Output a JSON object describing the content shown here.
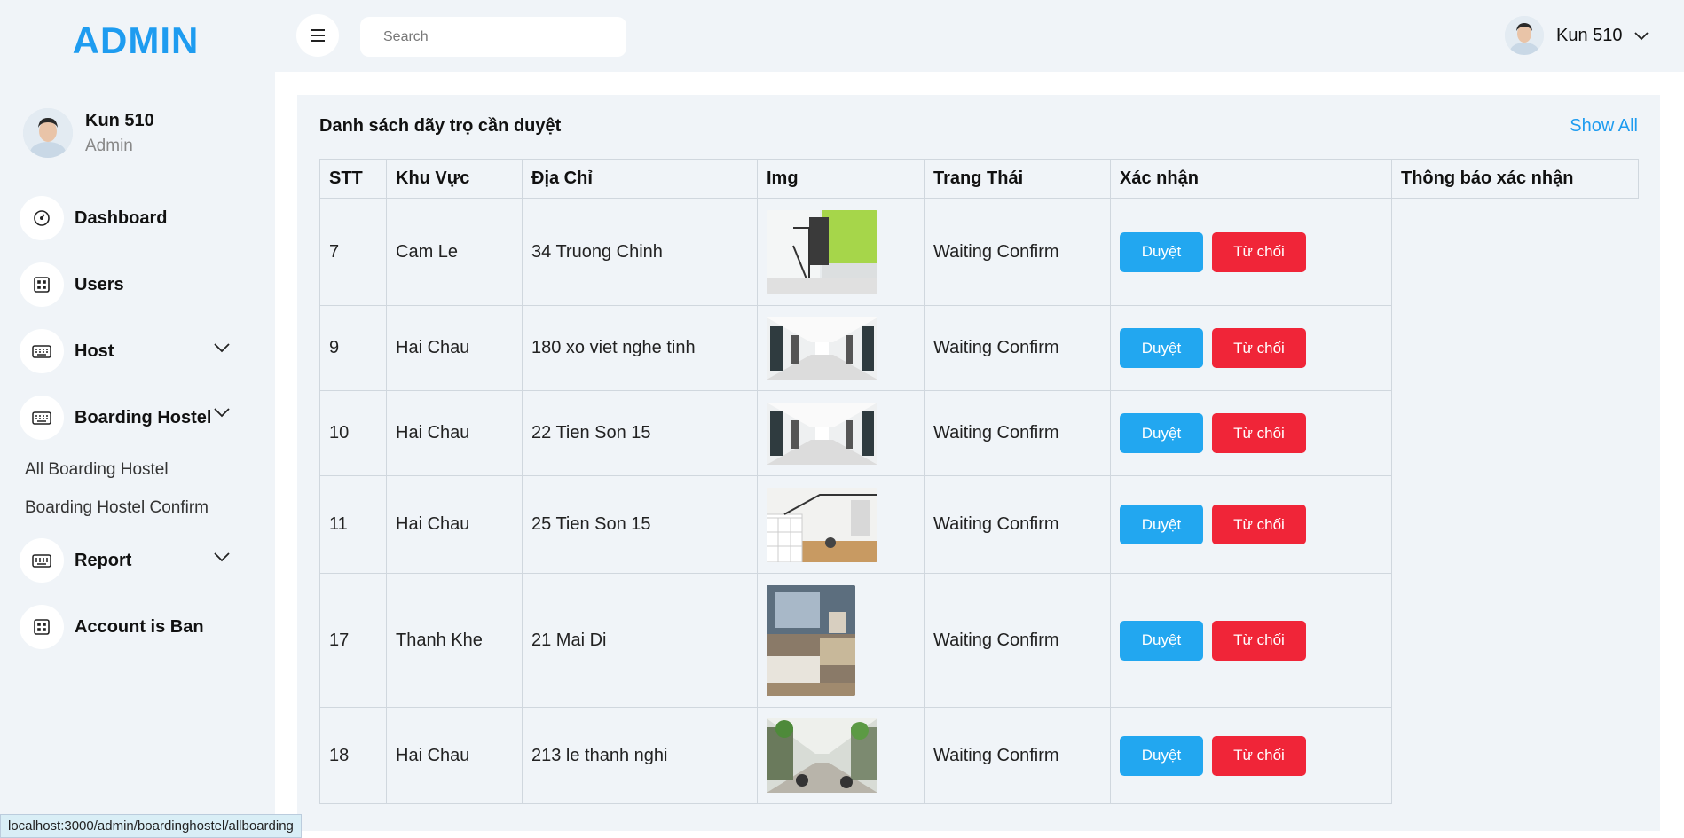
{
  "brand": "ADMIN",
  "profile": {
    "name": "Kun 510",
    "role": "Admin"
  },
  "nav": {
    "dashboard": "Dashboard",
    "users": "Users",
    "host": "Host",
    "boarding": "Boarding Hostel",
    "sub_all": "All Boarding Hostel",
    "sub_confirm": "Boarding Hostel Confirm",
    "report": "Report",
    "banned": "Account is Ban"
  },
  "topbar": {
    "search_placeholder": "Search",
    "user_name": "Kun 510"
  },
  "card": {
    "title": "Danh sách dãy trọ cần duyệt",
    "show_all": "Show All"
  },
  "table": {
    "headers": {
      "stt": "STT",
      "area": "Khu Vực",
      "address": "Địa Chỉ",
      "img": "Img",
      "status": "Trang Thái",
      "confirm": "Xác nhận",
      "notice": "Thông báo xác nhận"
    },
    "approve_label": "Duyệt",
    "reject_label": "Từ chối",
    "rows": [
      {
        "stt": "7",
        "area": "Cam Le",
        "address": "34 Truong Chinh",
        "status": "Waiting Confirm"
      },
      {
        "stt": "9",
        "area": "Hai Chau",
        "address": "180 xo viet nghe tinh",
        "status": "Waiting Confirm"
      },
      {
        "stt": "10",
        "area": "Hai Chau",
        "address": "22 Tien Son 15",
        "status": "Waiting Confirm"
      },
      {
        "stt": "11",
        "area": "Hai Chau",
        "address": "25 Tien Son 15",
        "status": "Waiting Confirm"
      },
      {
        "stt": "17",
        "area": "Thanh Khe",
        "address": "21 Mai Di",
        "status": "Waiting Confirm"
      },
      {
        "stt": "18",
        "area": "Hai Chau",
        "address": "213 le thanh nghi",
        "status": "Waiting Confirm"
      }
    ]
  },
  "status_url": "localhost:3000/admin/boardinghostel/allboarding"
}
